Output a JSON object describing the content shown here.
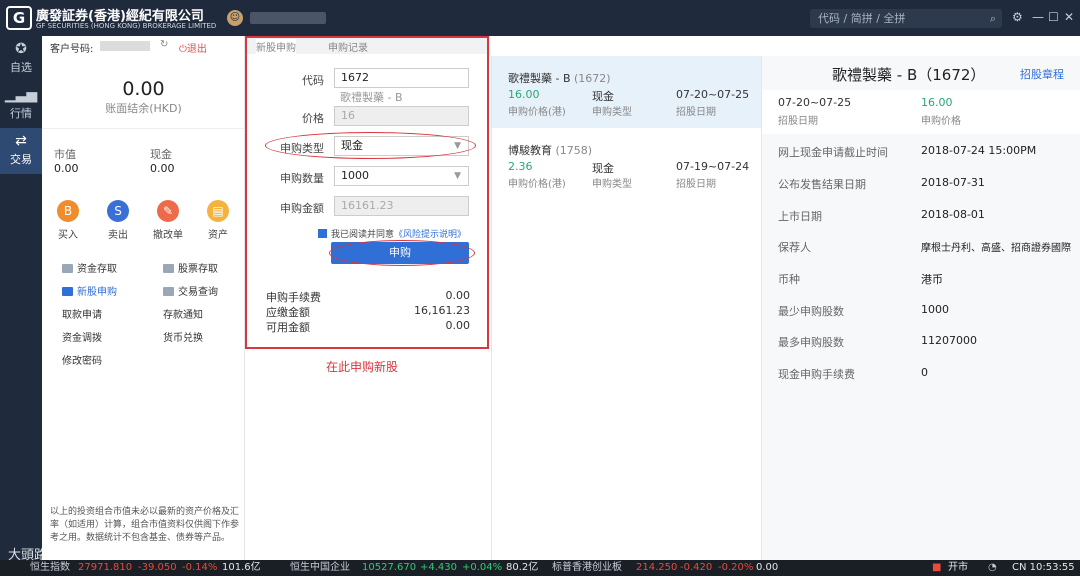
{
  "titlebar": {
    "company_cn": "廣發証券(香港)經紀有限公司",
    "company_en": "GF SECURITIES (HONG KONG) BROKERAGE LIMITED",
    "logo": "G",
    "search_placeholder": "代码 / 简拼 / 全拼",
    "icons": [
      "search-icon",
      "gear-icon",
      "minimize-icon",
      "maximize-icon",
      "close-icon"
    ]
  },
  "nav": {
    "items": [
      {
        "label": "自选",
        "icon": "star-icon"
      },
      {
        "label": "行情",
        "icon": "bar-chart-icon"
      },
      {
        "label": "交易",
        "icon": "trade-icon"
      }
    ]
  },
  "account": {
    "client_label": "客户号码:",
    "logout": "退出",
    "cash_value": "0.00",
    "cash_label": "账面结余(HKD)",
    "market_value_label": "市值",
    "market_value": "0.00",
    "cash_label2": "现金",
    "cash2": "0.00",
    "quick_actions": [
      {
        "label": "买入",
        "glyph": "B",
        "color": "#f08c2b"
      },
      {
        "label": "卖出",
        "glyph": "S",
        "color": "#3a6fd8"
      },
      {
        "label": "撤改单",
        "glyph": "✎",
        "color": "#ef6a4b"
      },
      {
        "label": "资产",
        "glyph": "▤",
        "color": "#f3b33d"
      }
    ],
    "menu": [
      {
        "label": "资金存取"
      },
      {
        "label": "股票存取"
      },
      {
        "label": "新股申购"
      },
      {
        "label": "交易查询"
      },
      {
        "label": "取款申请"
      },
      {
        "label": "存款通知"
      },
      {
        "label": "资金调拨"
      },
      {
        "label": "货币兑换"
      },
      {
        "label": "修改密码"
      }
    ],
    "notice": "以上的投资组合市值未必以最新的资产价格及汇率（如适用）计算，组合市值资料仅供阁下作参考之用。数据统计不包含基金、债券等产品。"
  },
  "form": {
    "tabs": [
      "新股申购",
      "申购记录"
    ],
    "code_label": "代码",
    "code_value": "1672",
    "name_hint": "歌禮製藥 - B",
    "price_label": "价格",
    "price_value": "16",
    "type_label": "申购类型",
    "type_value": "现金",
    "qty_label": "申购数量",
    "qty_value": "1000",
    "amount_label": "申购金额",
    "amount_value": "16161.23",
    "agree_text": "我已阅读并同意",
    "agree_link": "《风险提示说明》",
    "submit": "申购",
    "fee_label": "申购手续费",
    "fee_value": "0.00",
    "due_label": "应缴金额",
    "due_value": "16,161.23",
    "avail_label": "可用金额",
    "avail_value": "0.00",
    "caption": "在此申购新股"
  },
  "ipo_list": [
    {
      "name": "歌禮製藥 - B",
      "code": "(1672)",
      "price": "16.00",
      "type": "现金",
      "dates": "07-20~07-25",
      "price_label": "申购价格(港)",
      "type_label": "申购类型",
      "date_label": "招股日期"
    },
    {
      "name": "博駿教育",
      "code": "(1758)",
      "price": "2.36",
      "type": "现金",
      "dates": "07-19~07-24",
      "price_label": "申购价格(港)",
      "type_label": "申购类型",
      "date_label": "招股日期"
    }
  ],
  "detail": {
    "title": "歌禮製藥 - B（1672）",
    "link": "招股章程",
    "head_dates": "07-20~07-25",
    "head_dates_label": "招股日期",
    "head_price": "16.00",
    "head_price_label": "申购价格",
    "rows": [
      {
        "label": "网上现金申请截止时间",
        "value": "2018-07-24 15:00PM"
      },
      {
        "label": "公布发售结果日期",
        "value": "2018-07-31"
      },
      {
        "label": "上市日期",
        "value": "2018-08-01"
      },
      {
        "label": "保荐人",
        "value": "摩根士丹利、高盛、招商證券國際"
      },
      {
        "label": "币种",
        "value": "港币"
      },
      {
        "label": "最少申购股数",
        "value": "1000"
      },
      {
        "label": "最多申购股数",
        "value": "11207000"
      },
      {
        "label": "现金申购手续费",
        "value": "0"
      }
    ]
  },
  "ticker": {
    "idx1_name": "恒生指数",
    "idx1_val": "27971.810",
    "idx1_chg": "-39.050",
    "idx1_pct": "-0.14%",
    "idx1_vol": "101.6亿",
    "idx2_name": "恒生中国企业",
    "idx2_val": "10527.670",
    "idx2_chg": "+4.430",
    "idx2_pct": "+0.04%",
    "idx2_vol": "80.2亿",
    "idx3_name": "标普香港创业板",
    "idx3_val": "214.250",
    "idx3_chg": "-0.420",
    "idx3_pct": "-0.20%",
    "idx3_vol": "0.00",
    "status": "开市",
    "clock": "CN 10:53:55"
  },
  "watermark": "大頭路偵",
  "colors": {
    "accent": "#2f6fd6",
    "up": "#2aa876",
    "down": "#e74c3c",
    "annotation": "#d9363e"
  }
}
